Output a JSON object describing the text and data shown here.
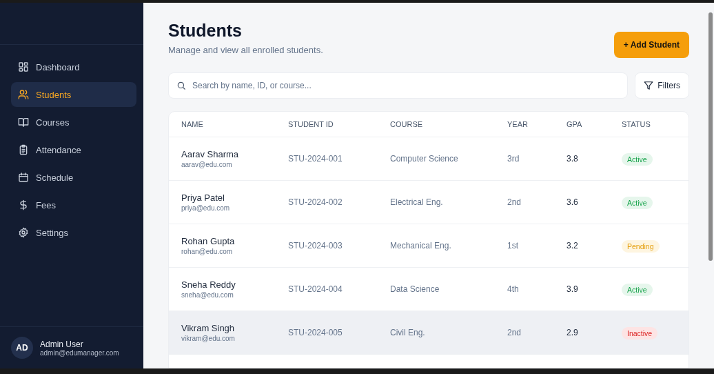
{
  "sidebar": {
    "items": [
      {
        "label": "Dashboard",
        "selected": false
      },
      {
        "label": "Students",
        "selected": true
      },
      {
        "label": "Courses",
        "selected": false
      },
      {
        "label": "Attendance",
        "selected": false
      },
      {
        "label": "Schedule",
        "selected": false
      },
      {
        "label": "Fees",
        "selected": false
      },
      {
        "label": "Settings",
        "selected": false
      }
    ],
    "user": {
      "initials": "AD",
      "name": "Admin User",
      "email": "admin@edumanager.com"
    }
  },
  "header": {
    "title": "Students",
    "subtitle": "Manage and view all enrolled students.",
    "add_button": "+ Add Student"
  },
  "search": {
    "placeholder": "Search by name, ID, or course..."
  },
  "filters_button": "Filters",
  "table": {
    "columns": [
      "NAME",
      "STUDENT ID",
      "COURSE",
      "YEAR",
      "GPA",
      "STATUS"
    ],
    "rows": [
      {
        "name": "Aarav Sharma",
        "email": "aarav@edu.com",
        "id": "STU-2024-001",
        "course": "Computer Science",
        "year": "3rd",
        "gpa": "3.8",
        "status": "Active",
        "kind": "success",
        "hovered": false
      },
      {
        "name": "Priya Patel",
        "email": "priya@edu.com",
        "id": "STU-2024-002",
        "course": "Electrical Eng.",
        "year": "2nd",
        "gpa": "3.6",
        "status": "Active",
        "kind": "success",
        "hovered": false
      },
      {
        "name": "Rohan Gupta",
        "email": "rohan@edu.com",
        "id": "STU-2024-003",
        "course": "Mechanical Eng.",
        "year": "1st",
        "gpa": "3.2",
        "status": "Pending",
        "kind": "warning",
        "hovered": false
      },
      {
        "name": "Sneha Reddy",
        "email": "sneha@edu.com",
        "id": "STU-2024-004",
        "course": "Data Science",
        "year": "4th",
        "gpa": "3.9",
        "status": "Active",
        "kind": "success",
        "hovered": false
      },
      {
        "name": "Vikram Singh",
        "email": "vikram@edu.com",
        "id": "STU-2024-005",
        "course": "Civil Eng.",
        "year": "2nd",
        "gpa": "2.9",
        "status": "Inactive",
        "kind": "danger",
        "hovered": true
      }
    ]
  }
}
